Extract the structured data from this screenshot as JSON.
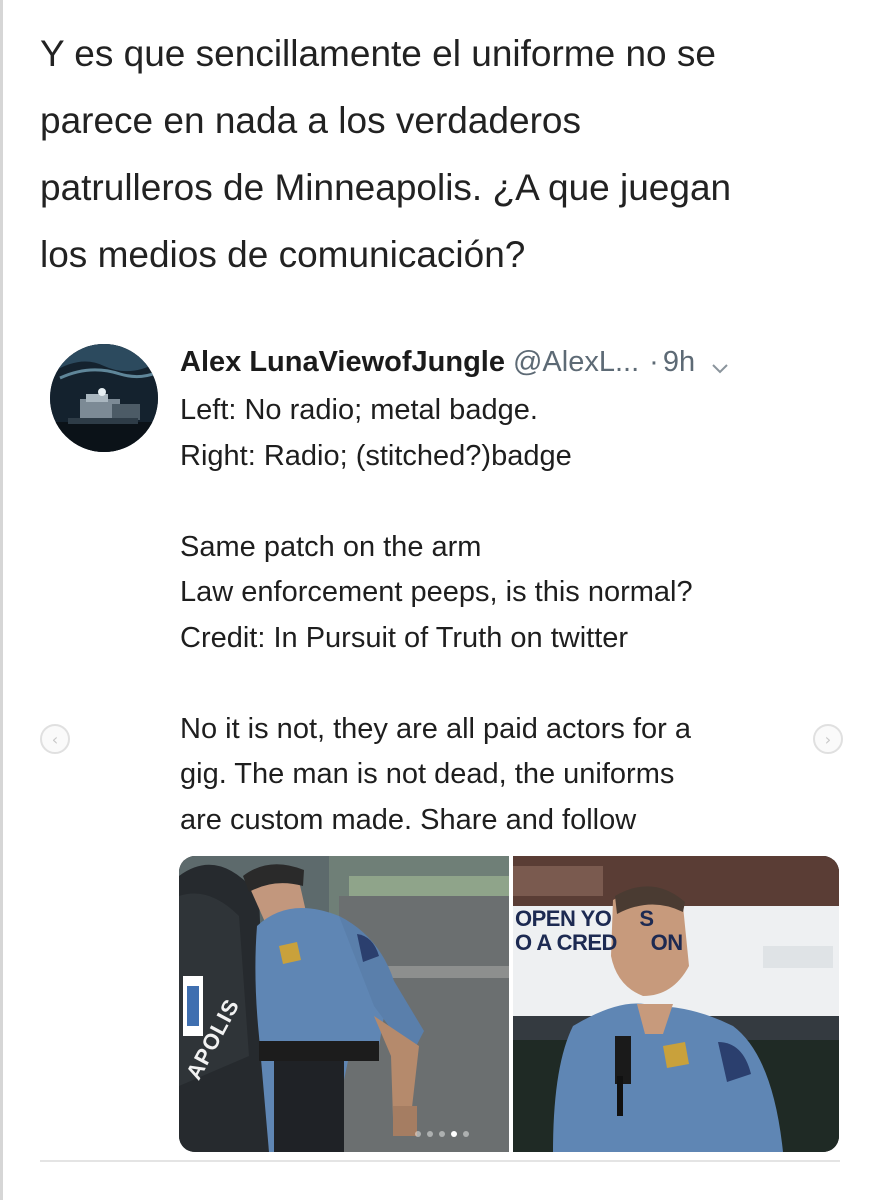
{
  "post": {
    "text": "Y es que sencillamente el uniforme no se\nparece en nada a los verdaderos\npatrulleros de Minneapolis. ¿A que juegan\nlos medios de comunicación?"
  },
  "tweet": {
    "author_name": "Alex LunaViewofJungle",
    "author_handle": "@AlexL...",
    "dot": "·",
    "time": "9h",
    "body": {
      "para1": "Left: No radio; metal badge.\nRight: Radio; (stitched?)badge",
      "para2": "Same patch on the arm\nLaw enforcement peeps, is this normal?\nCredit: In Pursuit of Truth on twitter",
      "para3": "No it is not, they are all paid actors for a\ngig. The man is not dead, the uniforms\nare custom made. Share and follow"
    },
    "media": {
      "left_car_text": "APOLIS",
      "right_sign_line1": "OPEN YO     S",
      "right_sign_line2": "O A CRED      ON",
      "carousel_count": 5,
      "carousel_active": 3
    }
  },
  "icons": {
    "chevron": "chevron-down-icon",
    "prev": "chevron-left-icon",
    "next": "chevron-right-icon"
  },
  "colors": {
    "text": "#222222",
    "muted": "#5d6a75",
    "uniform_blue": "#5f86b4"
  }
}
